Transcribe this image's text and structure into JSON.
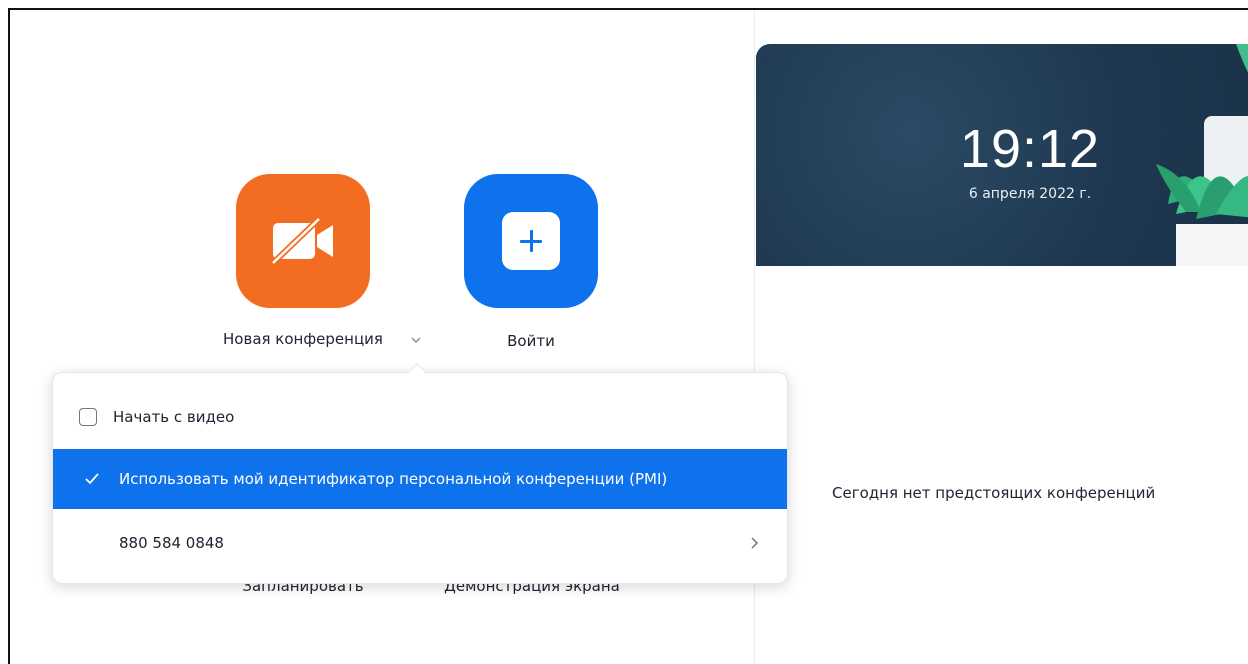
{
  "actions": {
    "new_meeting": {
      "label": "Новая конференция"
    },
    "join": {
      "label": "Войти"
    },
    "schedule": {
      "label": "Запланировать"
    },
    "share_screen": {
      "label": "Демонстрация экрана"
    }
  },
  "dropdown": {
    "start_with_video": {
      "label": "Начать с видео",
      "checked": false
    },
    "use_pmi": {
      "label": "Использовать мой идентификатор персональной конференции (PMI)",
      "checked": true
    },
    "pmi_number": "880 584 0848"
  },
  "banner": {
    "time": "19:12",
    "date": "6 апреля 2022 г."
  },
  "meetings": {
    "empty_message": "Сегодня нет предстоящих конференций"
  },
  "colors": {
    "orange_tile": "#f26d21",
    "blue_tile": "#0e72ed",
    "selected_row": "#0e72ed",
    "banner_bg": "#1f3a52"
  }
}
